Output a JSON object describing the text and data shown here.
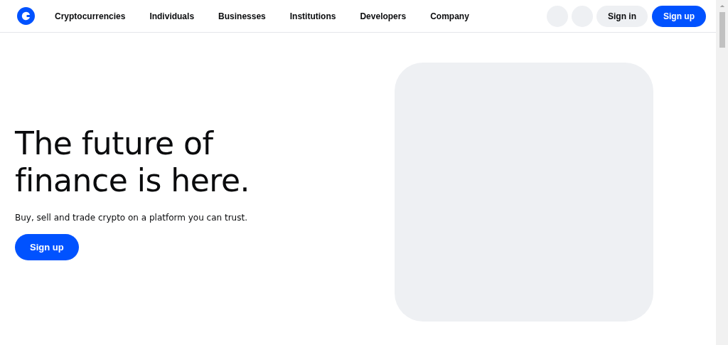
{
  "nav": {
    "items": [
      {
        "label": "Cryptocurrencies"
      },
      {
        "label": "Individuals"
      },
      {
        "label": "Businesses"
      },
      {
        "label": "Institutions"
      },
      {
        "label": "Developers"
      },
      {
        "label": "Company"
      }
    ],
    "sign_in": "Sign in",
    "sign_up": "Sign up"
  },
  "hero": {
    "heading_lines": [
      "The future of",
      "finance is here."
    ],
    "subtitle": "Buy, sell and trade crypto on a platform you can trust.",
    "button": "Sign up",
    "media": {
      "kind": "placeholder"
    }
  }
}
